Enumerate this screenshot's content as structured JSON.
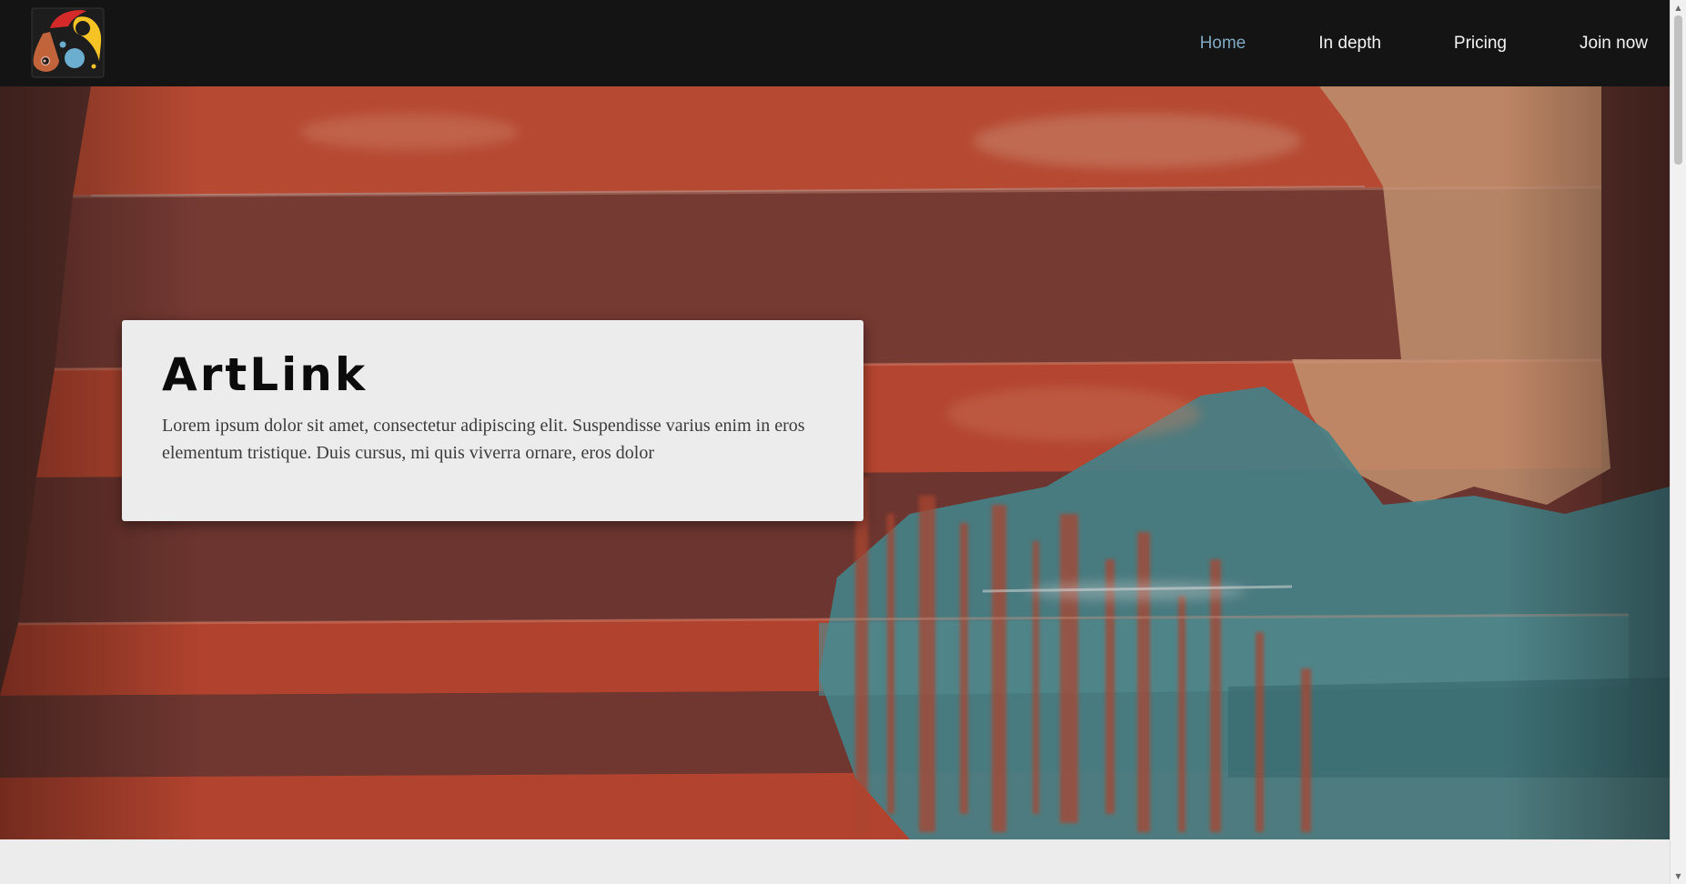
{
  "brand": {
    "logo_icon": "artlink-logo-icon",
    "colors": {
      "nav_bg": "#141414",
      "nav_text": "#f3f3f3",
      "nav_active": "#7fa9c3",
      "logo_red": "#d42a2a",
      "logo_yellow": "#f6c324",
      "logo_orange": "#c1643b",
      "logo_blue": "#6baed0"
    }
  },
  "nav": {
    "items": [
      {
        "label": "Home",
        "active": true
      },
      {
        "label": "In depth",
        "active": false
      },
      {
        "label": "Pricing",
        "active": false
      },
      {
        "label": "Join now",
        "active": false
      }
    ]
  },
  "hero": {
    "background_image": "painted-stairs-image",
    "title": "ArtLink",
    "text": "Lorem ipsum dolor sit amet, consectetur adipiscing elit. Suspendisse varius enim in eros elementum tristique. Duis cursus, mi quis viverra ornare, eros dolor"
  },
  "scrollbar": {
    "up_icon": "scroll-up-arrow-icon",
    "down_icon": "scroll-down-arrow-icon"
  }
}
